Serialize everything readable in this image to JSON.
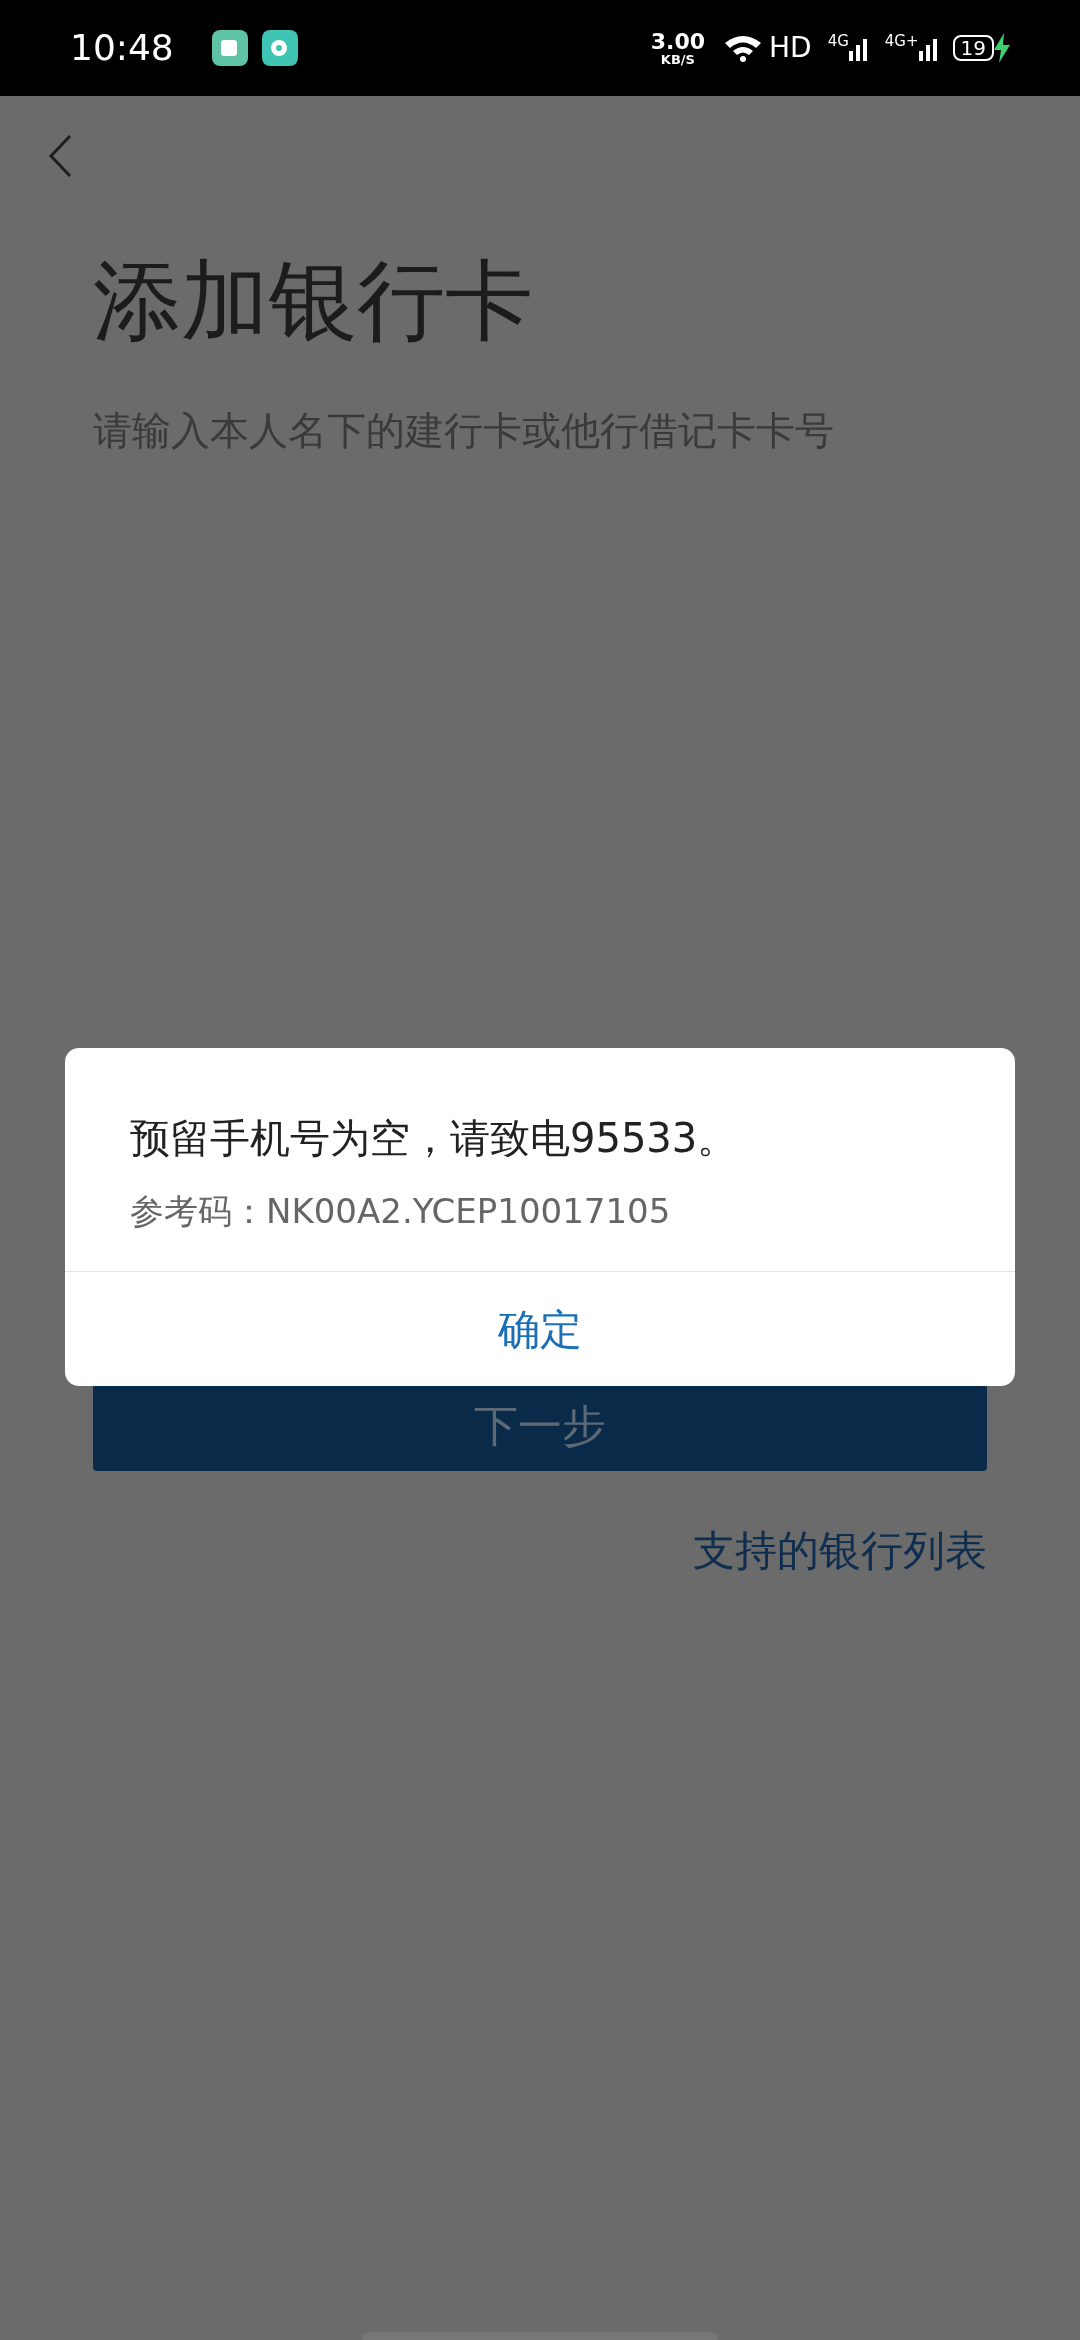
{
  "status_bar": {
    "time": "10:48",
    "speed_value": "3.00",
    "speed_unit": "KB/S",
    "hd": "HD",
    "network_1": "4G",
    "network_2": "4G+",
    "battery": "19",
    "charging": true
  },
  "page": {
    "title": "添加银行卡",
    "subtitle": "请输入本人名下的建行卡或他行借记卡卡号",
    "next_button": "下一步",
    "bank_list_link": "支持的银行列表"
  },
  "dialog": {
    "message": "预留手机号为空，请致电95533。",
    "reference": "参考码：NK00A2.YCEP10017105",
    "confirm_button": "确定"
  }
}
